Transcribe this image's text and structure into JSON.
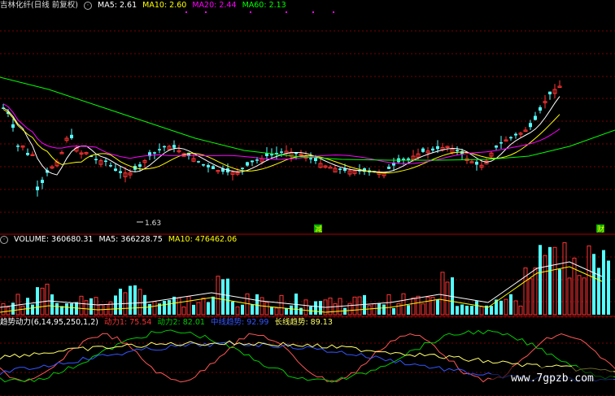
{
  "main_panel": {
    "stock_title": "吉林化纤(日线 前复权)",
    "ma_labels": [
      {
        "label": "MA5: 2.61",
        "color": "#ffffff"
      },
      {
        "label": "MA10: 2.60",
        "color": "#ffff00"
      },
      {
        "label": "MA20: 2.44",
        "color": "#ff00ff"
      },
      {
        "label": "MA60: 2.13",
        "color": "#00ff00"
      }
    ],
    "low_price_annotation": "1.63",
    "event_marks": [
      {
        "label": "减",
        "color": "#00cc00",
        "text_color": "#ffff00"
      },
      {
        "label": "财",
        "color": "#00cc00",
        "text_color": "#ffff00"
      }
    ]
  },
  "volume_panel": {
    "labels": [
      {
        "label": "VOLUME: 360680.31",
        "color": "#ffffff"
      },
      {
        "label": "MA5: 366228.75",
        "color": "#ffffff"
      },
      {
        "label": "MA10: 476462.06",
        "color": "#ffff00"
      }
    ]
  },
  "indicator_panel": {
    "labels": [
      {
        "label": "趋势动力(6,14,95,250,1,2)",
        "color": "#ffffff"
      },
      {
        "label": "动力1: 75.54",
        "color": "#ff3333"
      },
      {
        "label": "动力2: 82.01",
        "color": "#00cc00"
      },
      {
        "label": "中线趋势: 92.99",
        "color": "#3355ff"
      },
      {
        "label": "长线趋势: 89.13",
        "color": "#ffff66"
      }
    ]
  },
  "watermark": "www.7gpzb.com",
  "colors": {
    "up": "#ff3333",
    "down": "#54ffff",
    "grid": "#7a0000",
    "ma5": "#ffffff",
    "ma10": "#ffff00",
    "ma20": "#ff00ff",
    "ma60": "#00ff00"
  }
}
